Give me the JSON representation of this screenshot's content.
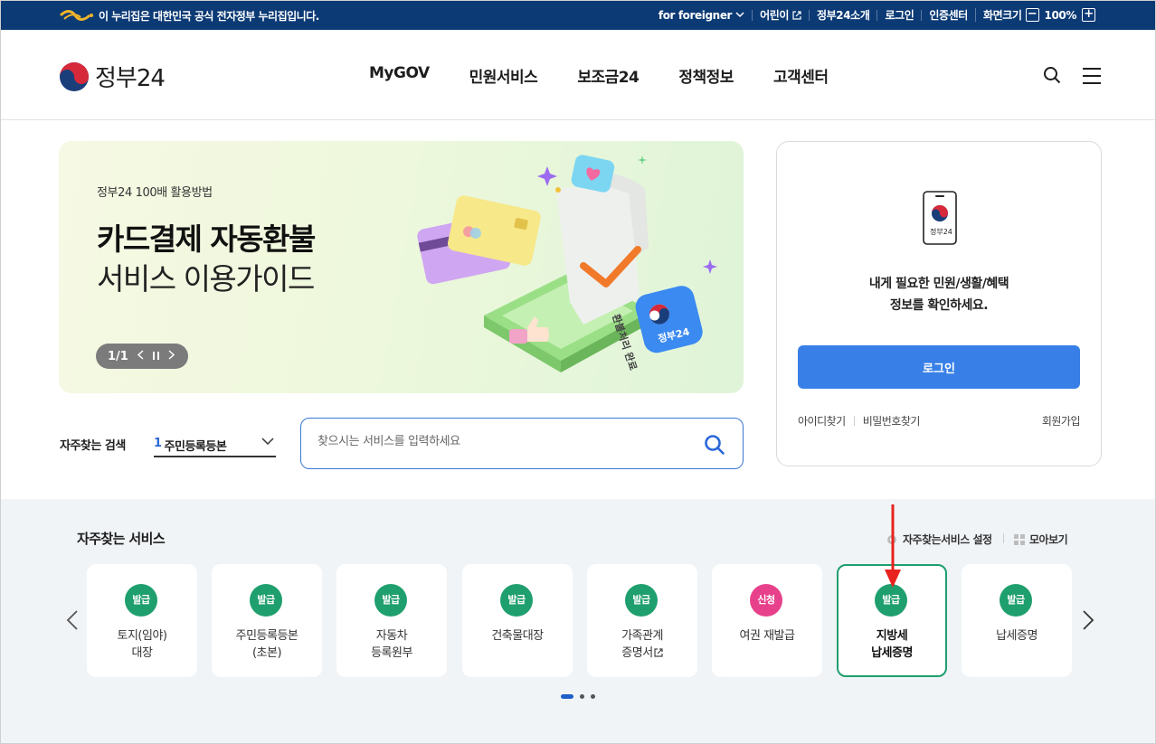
{
  "topbar": {
    "notice": "이 누리집은 대한민국 공식 전자정부 누리집입니다.",
    "util": [
      {
        "label": "for foreigner",
        "icon": "chevron-down-icon"
      },
      {
        "label": "어린이",
        "icon": "external-link-icon"
      },
      {
        "label": "정부24소개"
      },
      {
        "label": "로그인"
      },
      {
        "label": "인증센터"
      },
      {
        "label": "화면크기"
      }
    ],
    "zoom_value": "100%",
    "zoom_minus": "−",
    "zoom_plus": "+"
  },
  "header": {
    "logo_text": "정부24",
    "nav": [
      "MyGOV",
      "민원서비스",
      "보조금24",
      "정책정보",
      "고객센터"
    ]
  },
  "banner": {
    "subtitle": "정부24 100배 활용방법",
    "title_bold": "카드결제 자동환불",
    "title_light": "서비스 이용가이드",
    "page": "1/1",
    "receipt_text": "환불처리 완료",
    "badge_text": "정부24"
  },
  "login": {
    "phone_label": "정부24",
    "message_line1": "내게 필요한 민원/생활/혜택",
    "message_line2": "정보를 확인하세요.",
    "button": "로그인",
    "find_id": "아이디찾기",
    "find_pw": "비밀번호찾기",
    "join": "회원가입"
  },
  "search": {
    "label": "자주찾는 검색",
    "rank": "1",
    "selected": "주민등록등본",
    "placeholder": "찾으시는 서비스를 입력하세요"
  },
  "services": {
    "title": "자주찾는 서비스",
    "setting": "자주찾는서비스 설정",
    "view_all": "모아보기",
    "cards": [
      {
        "badge": "발급",
        "label": "토지(임야)\n대장"
      },
      {
        "badge": "발급",
        "label": "주민등록등본\n(초본)"
      },
      {
        "badge": "발급",
        "label": "자동차\n등록원부"
      },
      {
        "badge": "발급",
        "label": "건축물대장"
      },
      {
        "badge": "발급",
        "label": "가족관계\n증명서"
      },
      {
        "badge": "신청",
        "label": "여권 재발급"
      },
      {
        "badge": "발급",
        "label": "지방세\n납세증명"
      },
      {
        "badge": "발급",
        "label": "납세증명"
      }
    ],
    "active_index": 6
  },
  "colors": {
    "topbar": "#0b3a75",
    "primary": "#3880e8",
    "green": "#1f9e6e",
    "pink": "#e8418c",
    "annotation_arrow": "#e8231f"
  }
}
